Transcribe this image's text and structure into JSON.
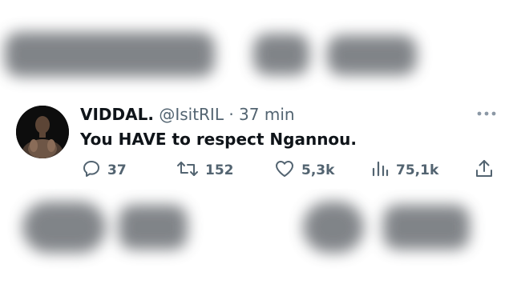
{
  "tweet": {
    "display_name": "VIDDAL.",
    "handle": "@IsitRIL",
    "separator": "·",
    "time": "37 min",
    "text": "You HAVE to respect Ngannou.",
    "stats": {
      "replies": "37",
      "retweets": "152",
      "likes": "5,3k",
      "views": "75,1k"
    }
  },
  "icons": {
    "more": "more-dots-icon",
    "reply": "reply-icon",
    "retweet": "retweet-icon",
    "like": "heart-icon",
    "views": "views-bar-chart-icon",
    "share": "share-upload-icon"
  },
  "colors": {
    "text_primary": "#0f1419",
    "text_secondary": "#536471"
  }
}
